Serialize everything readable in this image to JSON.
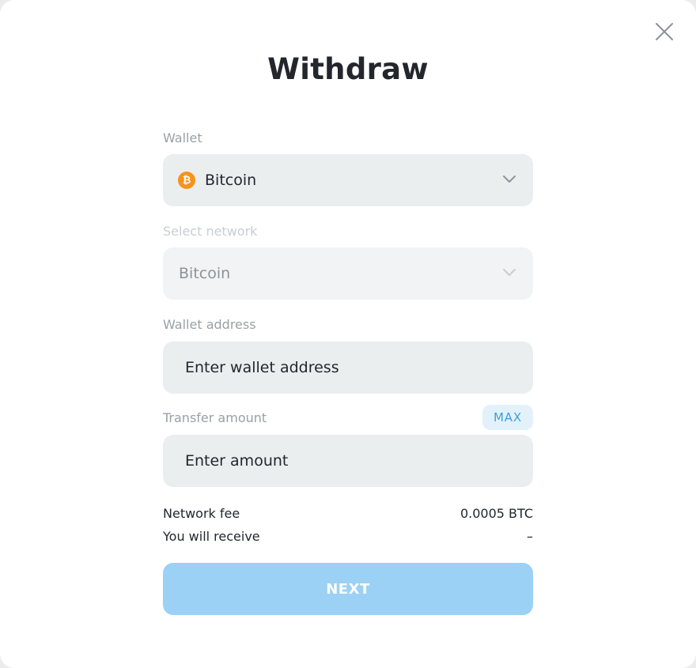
{
  "dialog": {
    "title": "Withdraw",
    "close_icon": "close-icon"
  },
  "wallet": {
    "label": "Wallet",
    "selected": "Bitcoin",
    "coin_icon": "bitcoin-icon",
    "coin_symbol": "₿"
  },
  "network": {
    "label": "Select network",
    "selected": "Bitcoin",
    "disabled": true
  },
  "address": {
    "label": "Wallet address",
    "placeholder": "Enter wallet address",
    "value": ""
  },
  "amount": {
    "label": "Transfer amount",
    "placeholder": "Enter amount",
    "value": "",
    "max_label": "MAX"
  },
  "summary": {
    "fee_label": "Network fee",
    "fee_value": "0.0005 BTC",
    "receive_label": "You will receive",
    "receive_value": "–"
  },
  "actions": {
    "next_label": "NEXT"
  },
  "colors": {
    "accent": "#3a9fe0",
    "button_disabled": "#9bd1f5",
    "field_bg": "#ebeeef",
    "bitcoin": "#f7931a"
  }
}
